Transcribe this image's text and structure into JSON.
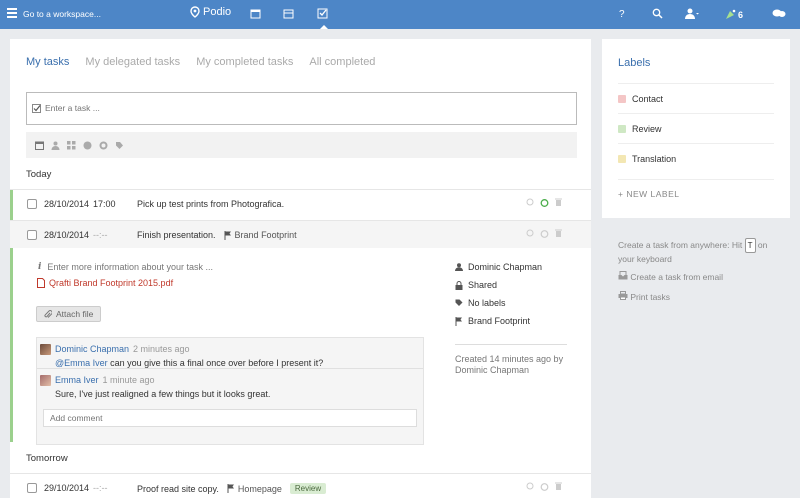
{
  "topbar": {
    "workspace_label": "Go to a workspace...",
    "logo_text": "Podio",
    "help": "?",
    "notifications_count": "6"
  },
  "tabs": [
    "My tasks",
    "My delegated tasks",
    "My completed tasks",
    "All completed"
  ],
  "task_input": {
    "placeholder": "Enter a task ..."
  },
  "sections": {
    "today": "Today",
    "tomorrow": "Tomorrow"
  },
  "tasks": [
    {
      "date": "28/10/2014",
      "time": "17:00",
      "title": "Pick up test prints from Photografica.",
      "ref": "",
      "badge": ""
    },
    {
      "date": "28/10/2014",
      "time": "--:--",
      "title": "Finish presentation.",
      "ref": "Brand Footprint",
      "badge": ""
    },
    {
      "date": "29/10/2014",
      "time": "--:--",
      "title": "Proof read site copy.",
      "ref": "Homepage",
      "badge": "Review"
    }
  ],
  "detail": {
    "info_placeholder": "Enter more information about your task ...",
    "file": "Qrafti Brand Footprint 2015.pdf",
    "attach": "Attach file",
    "meta": {
      "assignee": "Dominic Chapman",
      "shared": "Shared",
      "labels": "No labels",
      "ref": "Brand Footprint",
      "created": "Created 14 minutes ago by",
      "created_by": "Dominic Chapman"
    },
    "comments": [
      {
        "author": "Dominic Chapman",
        "when": "2 minutes ago",
        "mention": "@Emma Iver",
        "text": " can you give this a final once over before I present it?"
      },
      {
        "author": "Emma Iver",
        "when": "1 minute ago",
        "mention": "",
        "text": "Sure, I've just realigned a few things but it looks great."
      }
    ],
    "add_comment_placeholder": "Add comment"
  },
  "labels_panel": {
    "title": "Labels",
    "items": [
      {
        "name": "Contact",
        "color": "#f4c6c6"
      },
      {
        "name": "Review",
        "color": "#cfe8c4"
      },
      {
        "name": "Translation",
        "color": "#f3e7b3"
      }
    ],
    "new_label": "+ NEW LABEL"
  },
  "side": {
    "create_anywhere_1": "Create a task from anywhere: Hit",
    "key": "T",
    "create_anywhere_2": "on",
    "create_anywhere_3": "your keyboard",
    "email": "Create a task from email",
    "print": "Print tasks"
  }
}
